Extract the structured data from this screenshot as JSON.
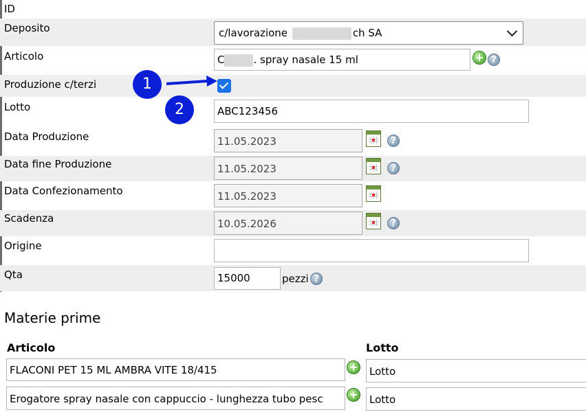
{
  "form": {
    "id_label": "ID",
    "deposito": {
      "label": "Deposito",
      "value_prefix": "c/lavorazione",
      "value_suffix": "ch SA"
    },
    "articolo": {
      "label": "Articolo",
      "value_prefix": "C",
      "value_suffix": ". spray nasale 15 ml"
    },
    "produzione_cterzi": {
      "label": "Produzione c/terzi",
      "checked": true
    },
    "lotto": {
      "label": "Lotto",
      "value": "ABC123456"
    },
    "data_produzione": {
      "label": "Data Produzione",
      "value": "11.05.2023"
    },
    "data_fine_produzione": {
      "label": "Data fine Produzione",
      "value": "11.05.2023"
    },
    "data_confezionamento": {
      "label": "Data Confezionamento",
      "value": "11.05.2023"
    },
    "scadenza": {
      "label": "Scadenza",
      "value": "10.05.2026"
    },
    "origine": {
      "label": "Origine",
      "value": ""
    },
    "qta": {
      "label": "Qta",
      "value": "15000",
      "unit": "pezzi"
    }
  },
  "annotations": {
    "one": "1",
    "two": "2"
  },
  "icons": {
    "help": "?",
    "add": "+"
  },
  "materie_prime": {
    "title": "Materie prime",
    "col_articolo": "Articolo",
    "col_lotto": "Lotto",
    "rows": [
      {
        "articolo": "FLACONI PET 15 ML AMBRA VITE 18/415",
        "lotto": "Lotto"
      },
      {
        "articolo": "Erogatore spray nasale con cappuccio - lunghezza tubo pesc",
        "lotto": "Lotto"
      }
    ]
  },
  "colors": {
    "accent": "#1a73e8",
    "annotation": "#0a1fd6",
    "row_alt": "#eeeeee"
  }
}
